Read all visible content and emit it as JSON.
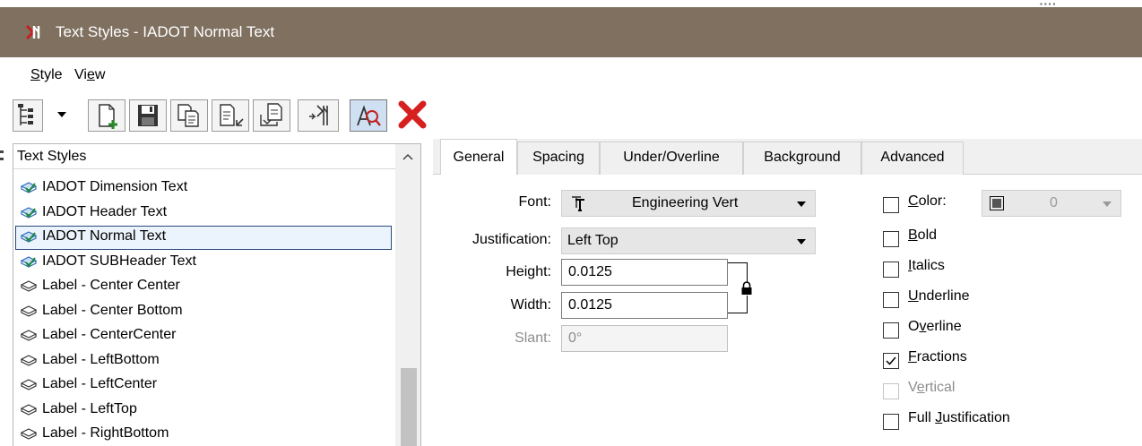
{
  "window": {
    "title": "Text Styles - IADOT Normal Text",
    "title_bar_color": "#7f705f",
    "app_icon": "microstation-app-icon"
  },
  "menu": {
    "items": [
      {
        "label": "Style",
        "mnemonic": "S"
      },
      {
        "label": "View",
        "mnemonic": "e"
      }
    ]
  },
  "toolbar": {
    "buttons": [
      {
        "icon": "tree-view-icon"
      },
      {
        "icon": "dropdown-arrow-icon"
      },
      {
        "icon": "new-style-icon"
      },
      {
        "icon": "save-icon"
      },
      {
        "icon": "copy-style-icon"
      },
      {
        "icon": "import-icon"
      },
      {
        "icon": "export-icon"
      },
      {
        "icon": "sync-icon"
      },
      {
        "icon": "preview-icon",
        "pressed": true
      },
      {
        "icon": "delete-icon",
        "color": "#d62020"
      }
    ]
  },
  "styles_list": {
    "header": "Text Styles",
    "selected_index": 2,
    "items": [
      {
        "label": "IADOT Dimension Text",
        "icon": "text-style-linked-icon"
      },
      {
        "label": "IADOT Header Text",
        "icon": "text-style-linked-icon"
      },
      {
        "label": "IADOT Normal Text",
        "icon": "text-style-linked-icon"
      },
      {
        "label": "IADOT SUBHeader Text",
        "icon": "text-style-linked-icon"
      },
      {
        "label": "Label - Center  Center",
        "icon": "text-style-icon"
      },
      {
        "label": "Label - Center Bottom",
        "icon": "text-style-icon"
      },
      {
        "label": "Label - CenterCenter",
        "icon": "text-style-icon"
      },
      {
        "label": "Label - LeftBottom",
        "icon": "text-style-icon"
      },
      {
        "label": "Label - LeftCenter",
        "icon": "text-style-icon"
      },
      {
        "label": "Label - LeftTop",
        "icon": "text-style-icon"
      },
      {
        "label": "Label - RightBottom",
        "icon": "text-style-icon"
      }
    ]
  },
  "tabs": [
    {
      "label": "General",
      "active": true
    },
    {
      "label": "Spacing",
      "active": false
    },
    {
      "label": "Under/Overline",
      "active": false
    },
    {
      "label": "Background",
      "active": false
    },
    {
      "label": "Advanced",
      "active": false
    }
  ],
  "general": {
    "font": {
      "label": "Font:",
      "value": "Engineering Vert",
      "icon": "truetype-font-icon"
    },
    "justification": {
      "label": "Justification:",
      "value": "Left Top"
    },
    "height": {
      "label": "Height:",
      "value": "0.0125"
    },
    "width": {
      "label": "Width:",
      "value": "0.0125"
    },
    "lock": {
      "icon": "lock-icon",
      "locked": true
    },
    "slant": {
      "label": "Slant:",
      "value": "0°",
      "disabled": true
    }
  },
  "options": {
    "color": {
      "label": "Color:",
      "checked": false,
      "value": "0",
      "swatch_color": "#555555",
      "disabled": true
    },
    "checkboxes": [
      {
        "label": "Bold",
        "mnemonic": "B",
        "checked": false,
        "disabled": false
      },
      {
        "label": "Italics",
        "mnemonic": "I",
        "checked": false,
        "disabled": false
      },
      {
        "label": "Underline",
        "mnemonic": "U",
        "checked": false,
        "disabled": false
      },
      {
        "label": "Overline",
        "mnemonic": "v",
        "checked": false,
        "disabled": false
      },
      {
        "label": "Fractions",
        "mnemonic": "F",
        "checked": true,
        "disabled": false
      },
      {
        "label": "Vertical",
        "mnemonic": "e",
        "checked": false,
        "disabled": true
      },
      {
        "label": "Full Justification",
        "mnemonic": "J",
        "checked": false,
        "disabled": false
      }
    ]
  }
}
